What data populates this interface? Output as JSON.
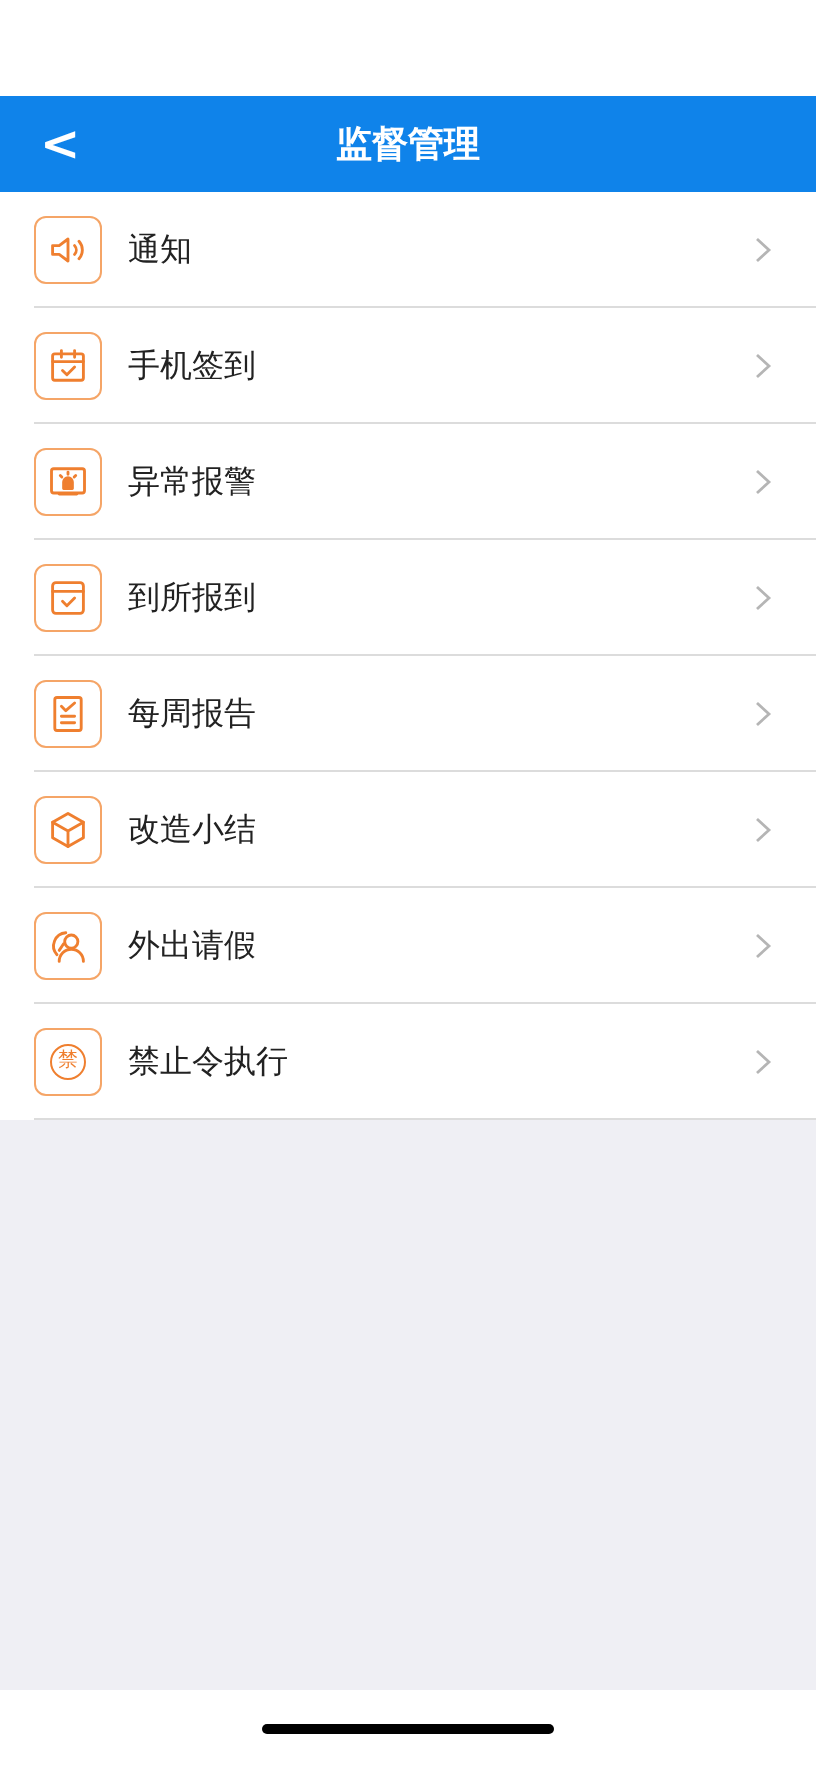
{
  "header": {
    "back": "<",
    "title": "监督管理"
  },
  "items": [
    {
      "label": "通知"
    },
    {
      "label": "手机签到"
    },
    {
      "label": "异常报警"
    },
    {
      "label": "到所报到"
    },
    {
      "label": "每周报告"
    },
    {
      "label": "改造小结"
    },
    {
      "label": "外出请假"
    },
    {
      "icon_text": "禁",
      "label": "禁止令执行"
    }
  ]
}
